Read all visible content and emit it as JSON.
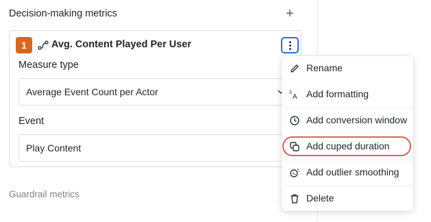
{
  "section": {
    "title": "Decision-making metrics",
    "add_icon": "plus-icon",
    "guardrail_title": "Guardrail metrics"
  },
  "metric": {
    "number": "1",
    "icon": "funnel-path-icon",
    "name": "Avg. Content Played Per User",
    "measure_type_label": "Measure type",
    "measure_type_value": "Average Event Count per Actor",
    "event_label": "Event",
    "event_value": "Play Content"
  },
  "menu": {
    "items": [
      {
        "label": "Rename",
        "icon": "pencil-icon"
      },
      {
        "label": "Add formatting",
        "icon": "superscript-format-icon"
      },
      {
        "label": "Add conversion window",
        "icon": "clock-icon"
      },
      {
        "label": "Add cuped duration",
        "icon": "copy-squares-icon"
      },
      {
        "label": "Add outlier smoothing",
        "icon": "sparkle-circle-icon"
      },
      {
        "label": "Delete",
        "icon": "trash-icon"
      }
    ],
    "highlighted_item": "Add cuped duration"
  },
  "colors": {
    "badge": "#d9651e",
    "focus_ring": "#2f6fd1",
    "highlight_ring": "#e0604c"
  }
}
